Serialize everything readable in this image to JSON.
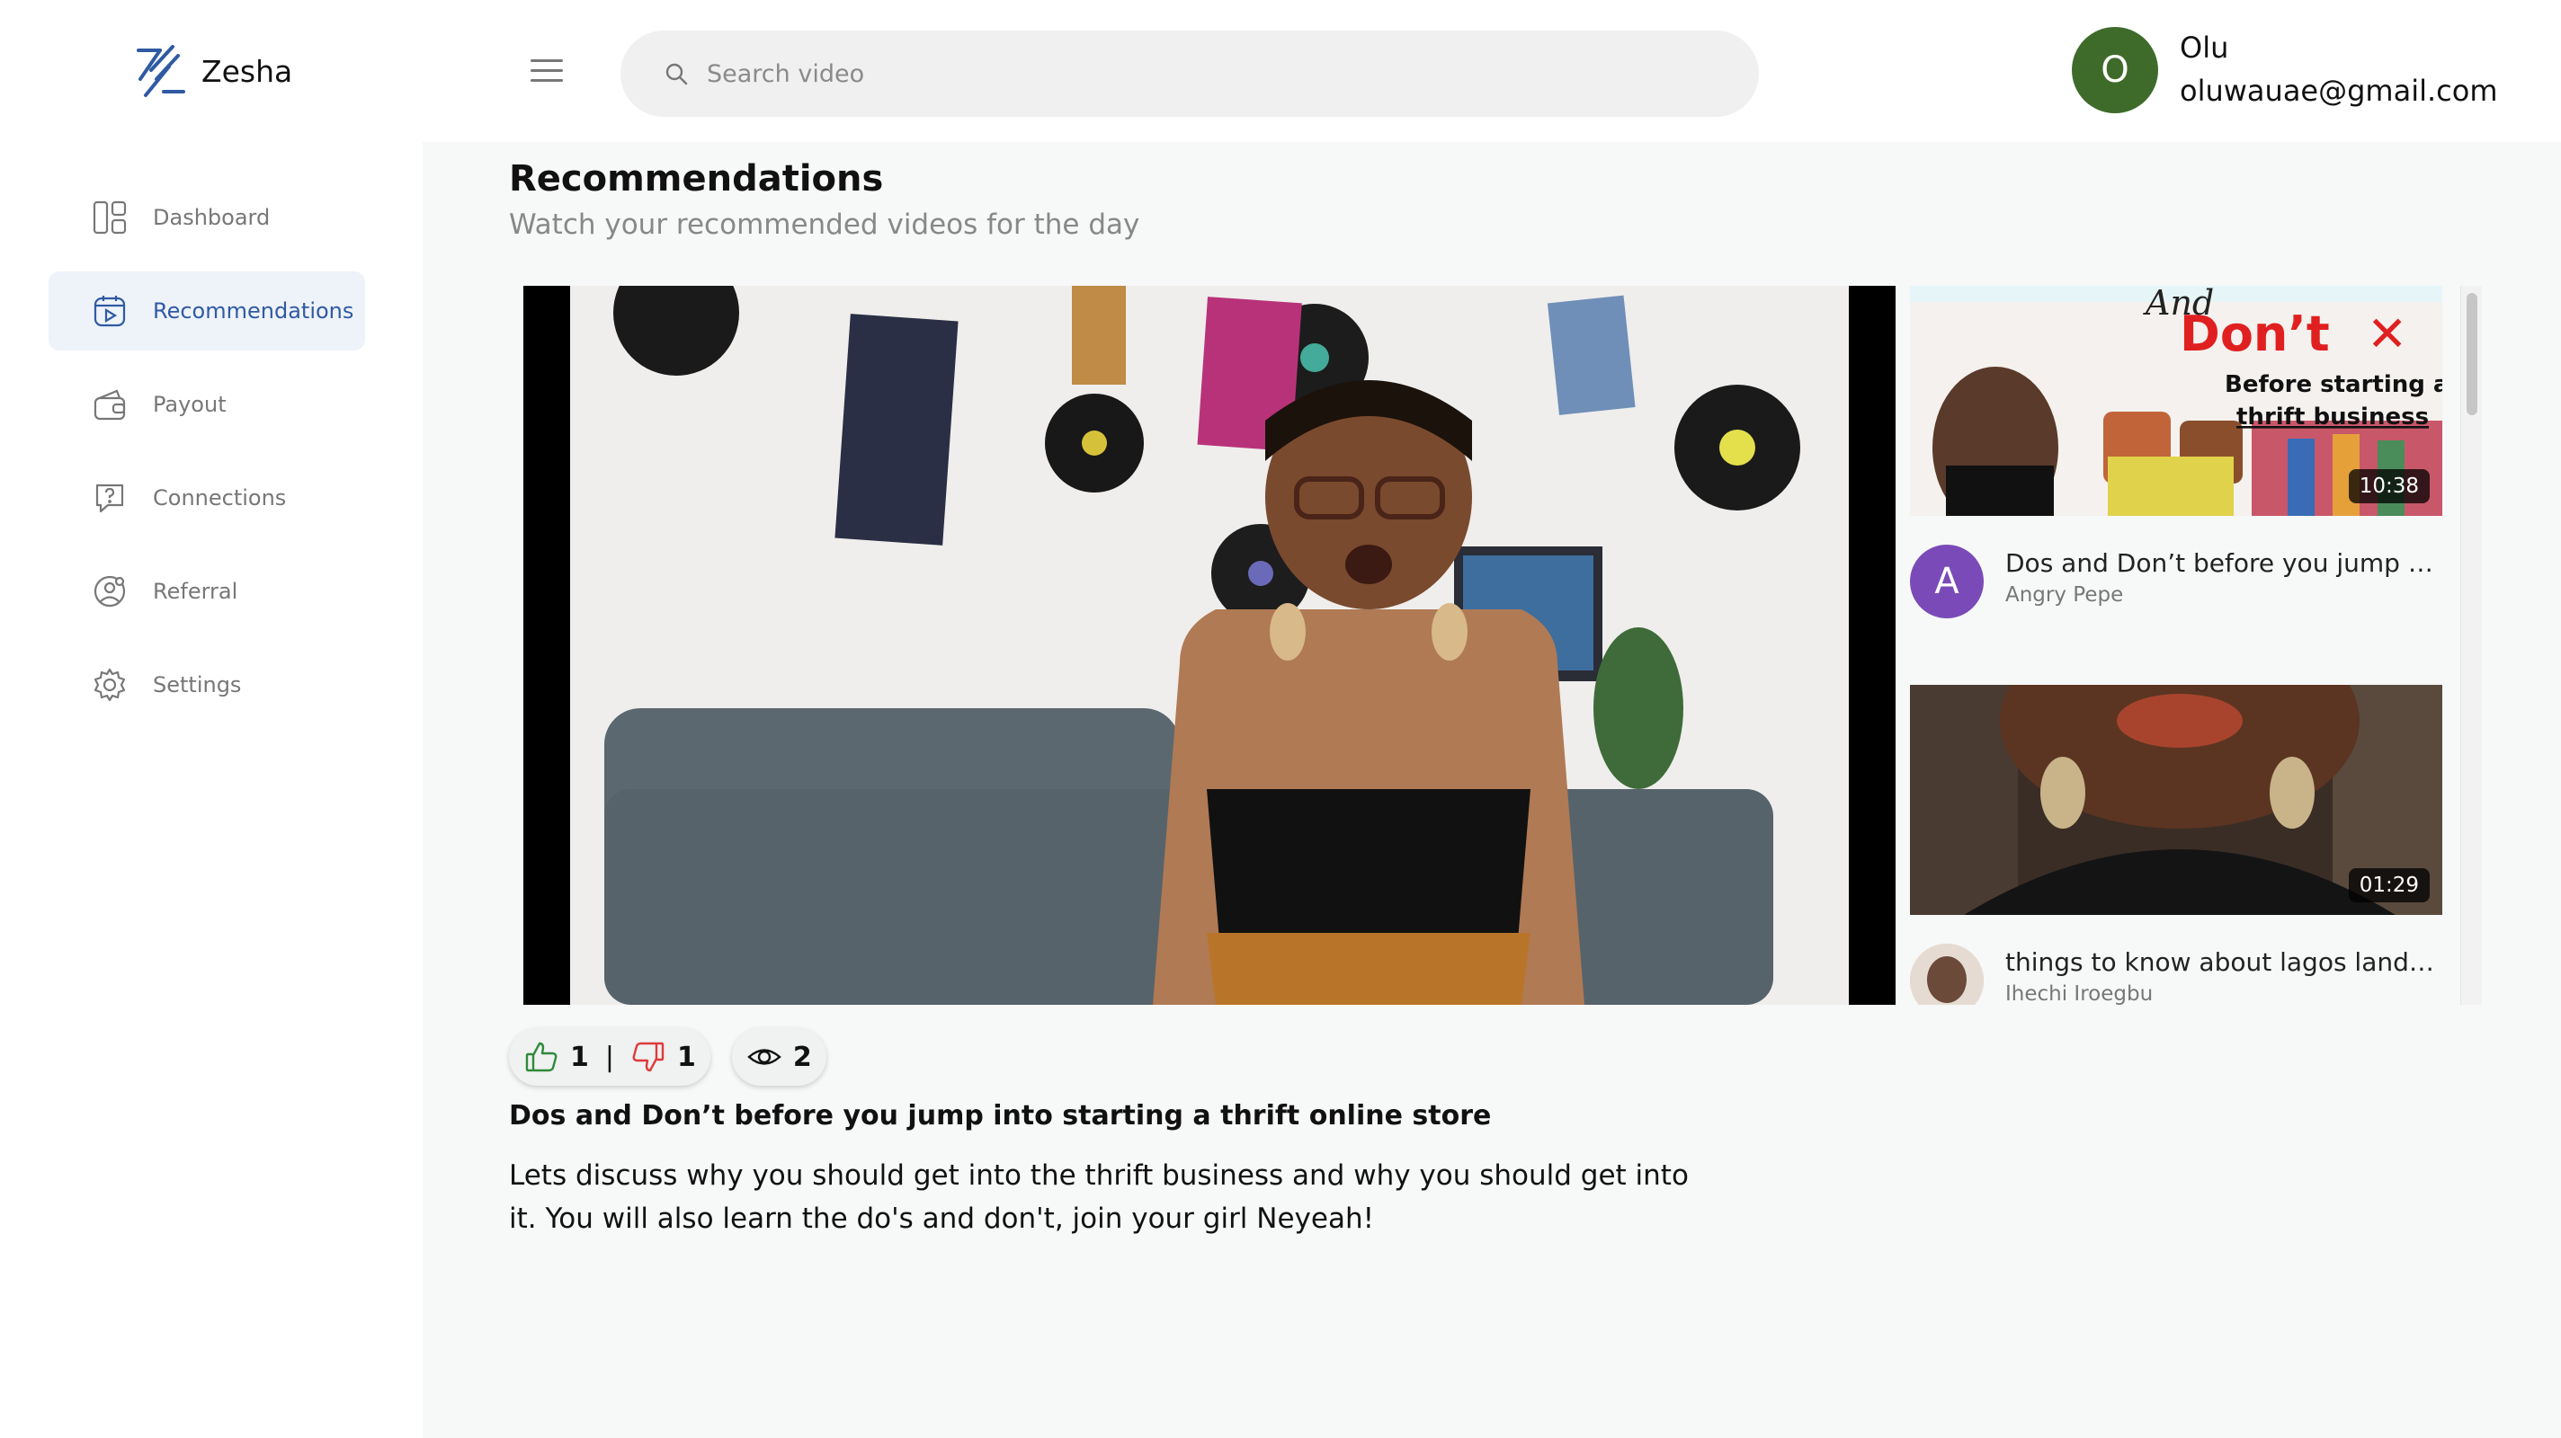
{
  "app": {
    "name": "Zesha",
    "brand_color": "#2f5aa3"
  },
  "sidebar": {
    "items": [
      {
        "label": "Dashboard",
        "icon": "dashboard-icon",
        "active": false
      },
      {
        "label": "Recommendations",
        "icon": "play-calendar-icon",
        "active": true
      },
      {
        "label": "Payout",
        "icon": "wallet-icon",
        "active": false
      },
      {
        "label": "Connections",
        "icon": "help-chat-icon",
        "active": false
      },
      {
        "label": "Referral",
        "icon": "user-circle-icon",
        "active": false
      },
      {
        "label": "Settings",
        "icon": "gear-icon",
        "active": false
      }
    ]
  },
  "header": {
    "search_placeholder": "Search video",
    "user": {
      "initial": "O",
      "name": "Olu",
      "email": "oluwauae@gmail.com",
      "avatar_color": "#3f6b2a"
    }
  },
  "main": {
    "title": "Recommendations",
    "subtitle": "Watch your recommended videos for the day",
    "video": {
      "likes": "1",
      "separator": "|",
      "dislikes": "1",
      "views": "2",
      "title": "Dos and Don’t before you jump into starting a thrift online store",
      "description": "Lets discuss why you should get into the thrift business and why you should get into it. You will also learn the do's and don't, join your girl Neyeah!"
    },
    "recommendations": [
      {
        "duration": "10:38",
        "title": "Dos and Don’t before you jump into starting a thrift online store",
        "channel": "Angry Pepe",
        "avatar_initial": "A",
        "avatar_color": "#7a4bb8",
        "thumb_text": {
          "line1": "And",
          "line2": "Don’t",
          "line3": "Before starting a",
          "line4": "thrift business"
        }
      },
      {
        "duration": "01:29",
        "title": "things to know about lagos landlords",
        "channel": "Ihechi Iroegbu",
        "avatar_initial": "",
        "avatar_color": "#6b4a3a"
      }
    ]
  }
}
